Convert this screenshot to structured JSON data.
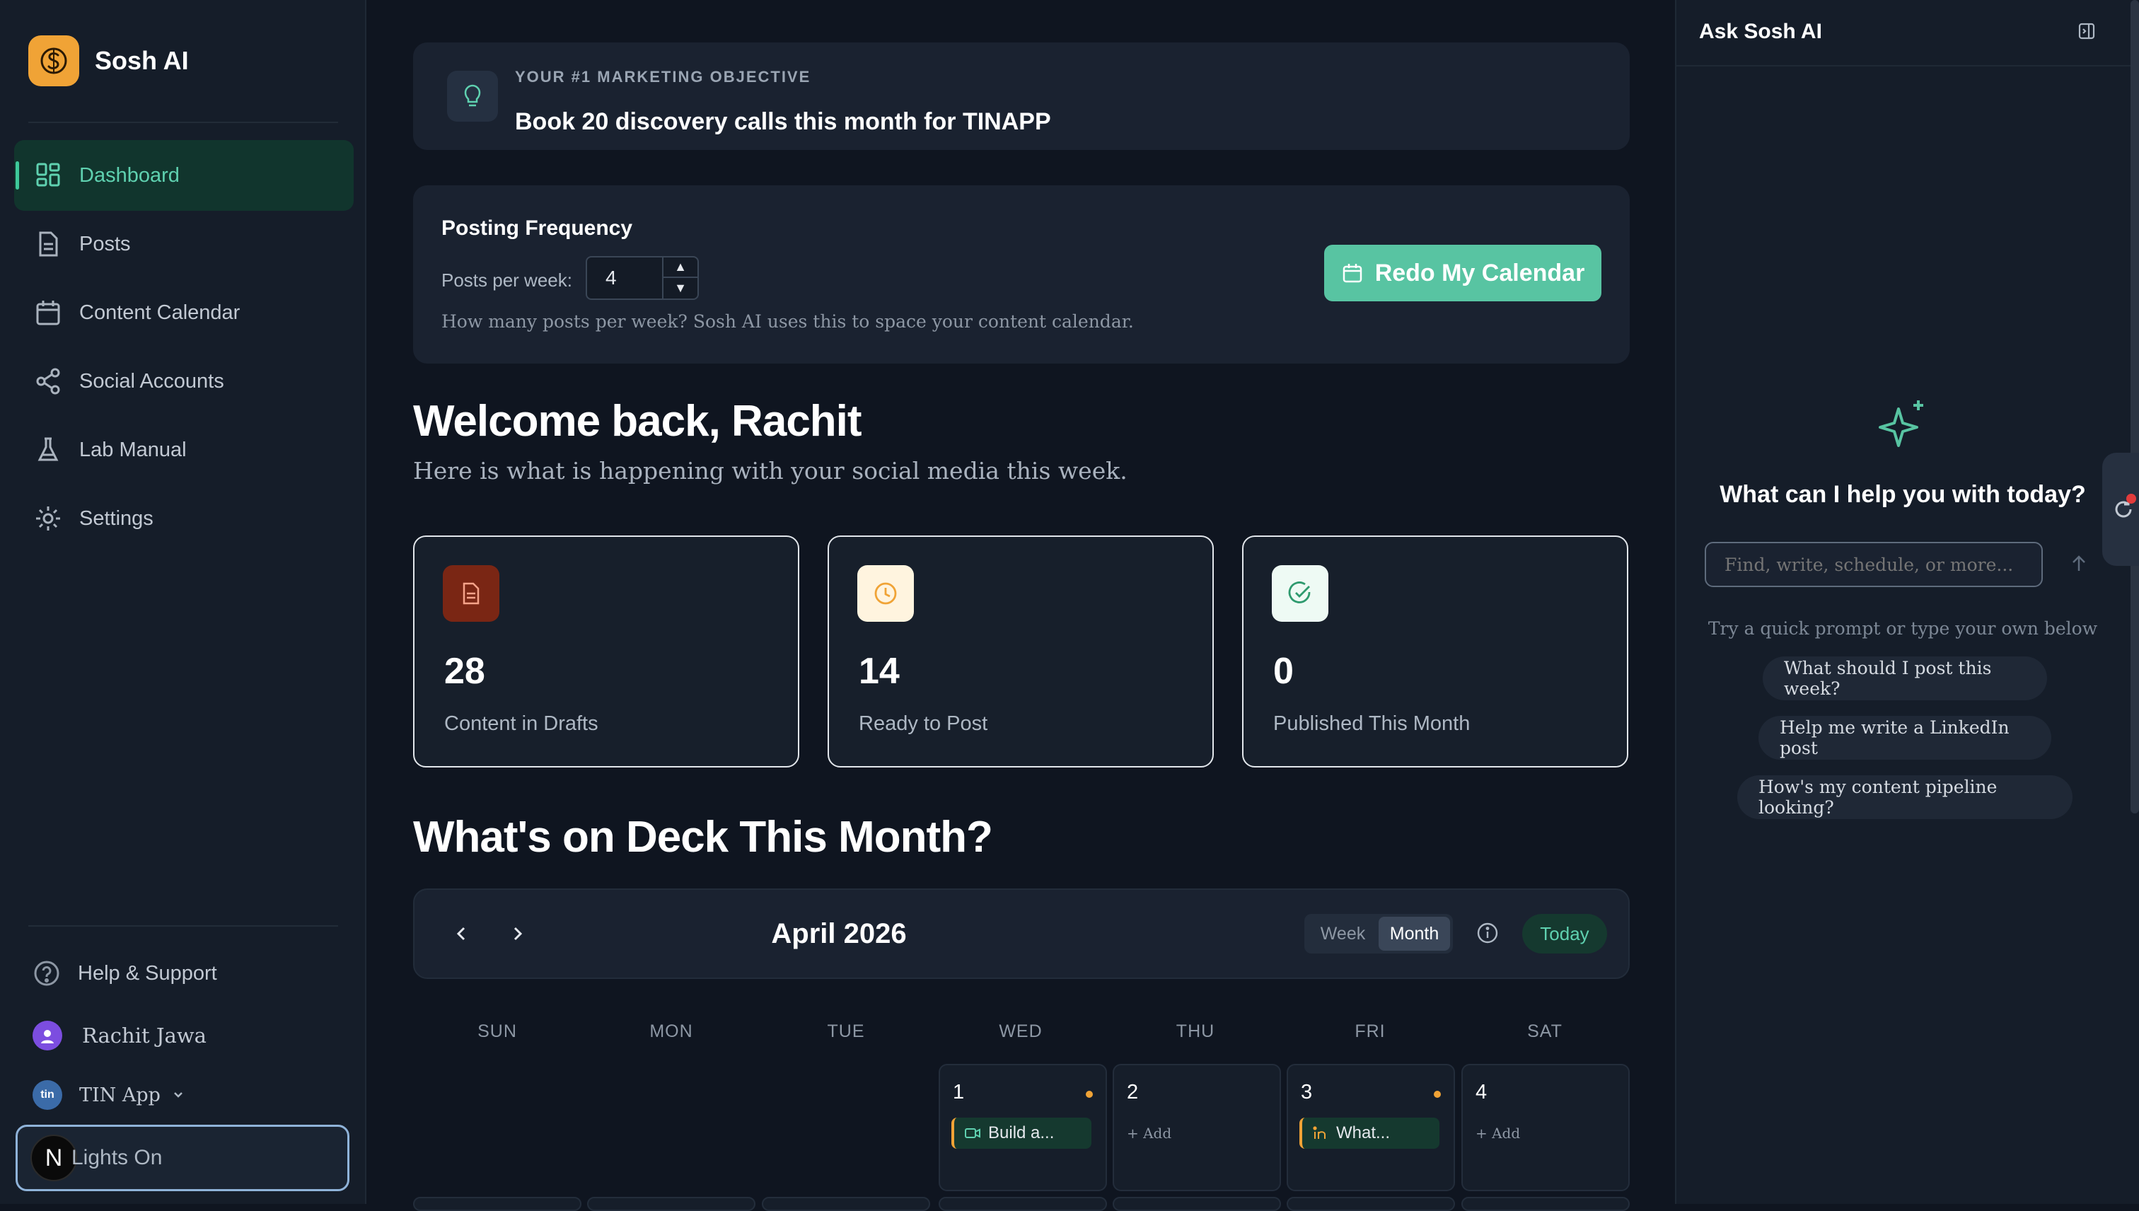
{
  "sidebar": {
    "brand": "Sosh AI",
    "nav": [
      {
        "label": "Dashboard",
        "icon": "dashboard-icon"
      },
      {
        "label": "Posts",
        "icon": "document-icon"
      },
      {
        "label": "Content Calendar",
        "icon": "calendar-icon"
      },
      {
        "label": "Social Accounts",
        "icon": "share-icon"
      },
      {
        "label": "Lab Manual",
        "icon": "flask-icon"
      },
      {
        "label": "Settings",
        "icon": "gear-icon"
      }
    ],
    "help": "Help & Support",
    "user_name": "Rachit Jawa",
    "workspace": "TIN App",
    "workspace_badge": "tin",
    "theme_toggle": "Lights On",
    "theme_badge": "N"
  },
  "objective": {
    "kicker": "YOUR #1 MARKETING OBJECTIVE",
    "title": "Book 20 discovery calls this month for TINAPP"
  },
  "frequency": {
    "title": "Posting Frequency",
    "label": "Posts per week:",
    "value": "4",
    "help": "How many posts per week? Sosh AI uses this to space your content calendar.",
    "button": "Redo My Calendar"
  },
  "welcome": {
    "title": "Welcome back, Rachit",
    "subtitle": "Here is what is happening with your social media this week."
  },
  "stats": [
    {
      "value": "28",
      "label": "Content in Drafts",
      "icon": "document-icon",
      "color": "#b3381f"
    },
    {
      "value": "14",
      "label": "Ready to Post",
      "icon": "clock-icon",
      "color": "#f0a336"
    },
    {
      "value": "0",
      "label": "Published This Month",
      "icon": "check-circle-icon",
      "color": "#2e9a6e"
    }
  ],
  "deck_title": "What's on Deck This Month?",
  "calendar": {
    "month": "April 2026",
    "views": [
      "Week",
      "Month"
    ],
    "active_view": "Month",
    "today": "Today",
    "weekdays": [
      "SUN",
      "MON",
      "TUE",
      "WED",
      "THU",
      "FRI",
      "SAT"
    ],
    "days": [
      {
        "num": "1",
        "dot": true,
        "event": "Build a...",
        "event_icon": "video-icon"
      },
      {
        "num": "2",
        "add": "+ Add"
      },
      {
        "num": "3",
        "dot": true,
        "event": "What...",
        "event_icon": "linkedin-icon"
      },
      {
        "num": "4",
        "add": "+ Add"
      }
    ]
  },
  "ai": {
    "title": "Ask Sosh AI",
    "question": "What can I help you with today?",
    "placeholder": "Find, write, schedule, or more...",
    "hint": "Try a quick prompt or type your own below",
    "chips": [
      "What should I post this week?",
      "Help me write a LinkedIn post",
      "How's my content pipeline looking?"
    ]
  },
  "colors": {
    "accent": "#58c4a2",
    "brand": "#f0a336",
    "background": "#0f1520"
  }
}
